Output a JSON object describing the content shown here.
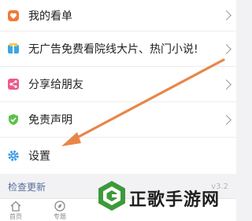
{
  "menu": {
    "items": [
      {
        "label": "我的看单",
        "icon": "heart-icon"
      },
      {
        "label": "无广告免费看院线大片、热门小说!",
        "icon": "gift-book-icon"
      },
      {
        "label": "分享给朋友",
        "icon": "share-icon"
      },
      {
        "label": "免责声明",
        "icon": "shield-icon"
      },
      {
        "label": "设置",
        "icon": "gear-icon"
      }
    ]
  },
  "check_update": {
    "label": "检查更新",
    "version": "v3.2"
  },
  "tabbar": {
    "tabs": [
      {
        "label": "首页",
        "icon": "home-icon"
      },
      {
        "label": "专题",
        "icon": "compass-icon"
      }
    ]
  },
  "watermark": {
    "text": "正歌手游网"
  },
  "colors": {
    "accent": "#e8864a",
    "heart": "#f07a3a",
    "share": "#ec5a8a",
    "shield": "#5cc24a",
    "gear": "#3a9be8",
    "link": "#5a6f9a"
  }
}
